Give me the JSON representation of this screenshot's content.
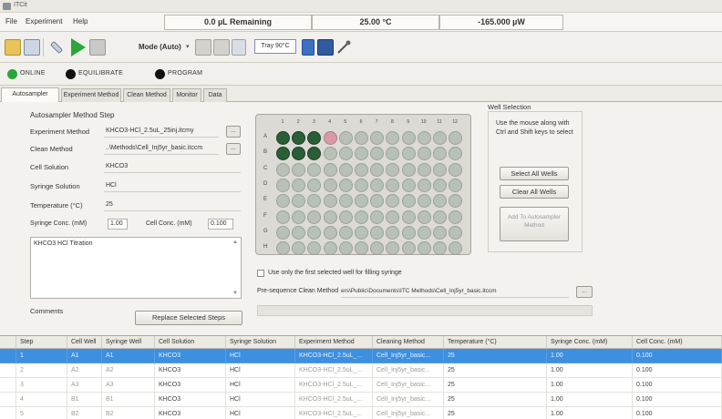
{
  "window": {
    "title": "ITCit"
  },
  "menu": {
    "file": "File",
    "experiment": "Experiment",
    "help": "Help"
  },
  "status": {
    "remaining": "0.0 µL Remaining",
    "temperature": "25.00 °C",
    "power": "-165.000 µW"
  },
  "toolbar": {
    "mode": "Mode (Auto)",
    "tray": "Tray 90°C"
  },
  "indicators": [
    {
      "label": "ONLINE",
      "color": "#27a637"
    },
    {
      "label": "EQUILIBRATE",
      "color": "#111111"
    },
    {
      "label": "PROGRAM",
      "color": "#111111"
    }
  ],
  "tabs": [
    "Autosampler Method",
    "Experiment Method",
    "Clean Method",
    "Monitor",
    "Data"
  ],
  "form": {
    "group_title": "Autosampler Method Step",
    "experiment_method_label": "Experiment Method",
    "experiment_method_value": "KHCO3-HCl_2.5uL_25inj.itcmy",
    "clean_method_label": "Clean Method",
    "clean_method_value": "..\\Methods\\Cell_Inj5yr_basic.itccm",
    "cell_solution_label": "Cell Solution",
    "cell_solution_value": "KHCO3",
    "syringe_solution_label": "Syringe Solution",
    "syringe_solution_value": "HCl",
    "temperature_label": "Temperature (°C)",
    "temperature_value": "25",
    "syringe_conc_label": "Syringe Conc. (mM)",
    "syringe_conc_value": "1.00",
    "cell_conc_label": "Cell Conc. (mM)",
    "cell_conc_value": "0.100",
    "description": "KHCO3 HCl Titration",
    "comments_label": "Comments",
    "replace_button": "Replace Selected Steps"
  },
  "plate": {
    "rows": [
      "A",
      "B",
      "C",
      "D",
      "E",
      "F",
      "G",
      "H"
    ],
    "columns": [
      "1",
      "2",
      "3",
      "4",
      "5",
      "6",
      "7",
      "8",
      "9",
      "10",
      "11",
      "12"
    ],
    "filled_wells": [
      "A1",
      "A2",
      "A3",
      "B1",
      "B2",
      "B3"
    ],
    "highlight_wells": [
      "A4"
    ],
    "filled_color": "#2a5e36",
    "empty_color": "#b9c0b9"
  },
  "well_selection": {
    "title": "Well Selection",
    "instructions": "Use the mouse along with Ctrl and Shift keys to select",
    "select_all": "Select All Wells",
    "clear_all": "Clear All Wells",
    "add_to": "Add To Autosampler Method"
  },
  "options": {
    "first_well_checkbox": "Use only the first selected well for filling syringe",
    "pre_sequence_label": "Pre-sequence Clean Method",
    "pre_sequence_value": "ers\\Public\\Documents\\ITC Methods\\Cell_Inj5yr_basic.itccm"
  },
  "table": {
    "columns": [
      "Step",
      "Cell Well",
      "Syringe Well",
      "Cell Solution",
      "Syringe Solution",
      "Experiment Method",
      "Cleaning Method",
      "Temperature (°C)",
      "Syringe Conc. (mM)",
      "Cell Conc. (mM)"
    ],
    "rows": [
      [
        "1",
        "A1",
        "A1",
        "KHCO3",
        "HCl",
        "KHCO3-HCl_2.5uL_...",
        "Cell_Inj5yr_basic...",
        "25",
        "1.00",
        "0.100"
      ],
      [
        "2",
        "A2",
        "A2",
        "KHCO3",
        "HCl",
        "KHCO3-HCl_2.5uL_...",
        "Cell_Inj5yr_basic...",
        "25",
        "1.00",
        "0.100"
      ],
      [
        "3",
        "A3",
        "A3",
        "KHCO3",
        "HCl",
        "KHCO3-HCl_2.5uL_...",
        "Cell_Inj5yr_basic...",
        "25",
        "1.00",
        "0.100"
      ],
      [
        "4",
        "B1",
        "B1",
        "KHCO3",
        "HCl",
        "KHCO3-HCl_2.5uL_...",
        "Cell_Inj5yr_basic...",
        "25",
        "1.00",
        "0.100"
      ],
      [
        "5",
        "B2",
        "B2",
        "KHCO3",
        "HCl",
        "KHCO3-HCl_2.5uL_...",
        "Cell_Inj5yr_basic...",
        "25",
        "1.00",
        "0.100"
      ]
    ]
  }
}
